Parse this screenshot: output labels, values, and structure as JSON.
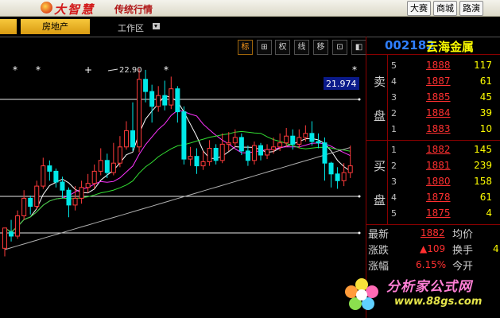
{
  "titlebar": {
    "app_name": "大智慧",
    "slogan": "传统行情",
    "buttons": [
      "大赛",
      "商城",
      "路演"
    ]
  },
  "tabs": {
    "sector": "房地产",
    "workspace": "工作区"
  },
  "chart_toolbar": {
    "buttons": [
      "标",
      "⊞",
      "权",
      "线",
      "移",
      "⊡",
      "◧"
    ]
  },
  "chart": {
    "high_label": "22.90",
    "cursor_value": "21.974",
    "candles": [
      [
        2.1,
        3.6,
        1.5,
        3.3
      ],
      [
        3.3,
        3.0,
        2.6,
        4.2
      ],
      [
        3.0,
        4.5,
        2.8,
        4.9
      ],
      [
        4.5,
        5.8,
        4.2,
        6.4
      ],
      [
        5.8,
        5.2,
        4.6,
        6.0
      ],
      [
        5.2,
        6.7,
        5.0,
        7.1
      ],
      [
        6.7,
        8.2,
        6.5,
        8.8
      ],
      [
        8.2,
        7.8,
        7.1,
        8.6
      ],
      [
        7.8,
        7.0,
        6.6,
        8.0
      ],
      [
        7.0,
        6.4,
        5.8,
        7.4
      ],
      [
        6.4,
        5.3,
        4.4,
        6.6
      ],
      [
        5.3,
        5.8,
        4.9,
        6.7
      ],
      [
        5.8,
        6.6,
        5.4,
        7.1
      ],
      [
        6.6,
        6.9,
        6.2,
        7.6
      ],
      [
        6.9,
        7.8,
        6.5,
        8.3
      ],
      [
        7.8,
        8.6,
        7.5,
        9.5
      ],
      [
        8.6,
        7.7,
        7.3,
        9.1
      ],
      [
        7.7,
        8.4,
        7.5,
        9.9
      ],
      [
        8.4,
        9.6,
        8.1,
        10.4
      ],
      [
        9.6,
        10.8,
        9.4,
        11.5
      ],
      [
        10.8,
        9.6,
        9.3,
        12.9
      ],
      [
        9.6,
        14.6,
        9.2,
        15.4
      ],
      [
        14.6,
        13.7,
        12.9,
        15.3
      ],
      [
        13.7,
        12.6,
        11.4,
        14.2
      ],
      [
        12.6,
        13.4,
        12.2,
        14.1
      ],
      [
        13.4,
        12.7,
        12.3,
        14.5
      ],
      [
        12.7,
        13.9,
        12.4,
        14.8
      ],
      [
        13.9,
        12.2,
        11.4,
        14.1
      ],
      [
        12.2,
        8.7,
        8.3,
        12.6
      ],
      [
        8.7,
        8.9,
        8.2,
        9.6
      ],
      [
        8.9,
        8.2,
        7.6,
        9.5
      ],
      [
        8.2,
        8.5,
        7.9,
        9.3
      ],
      [
        8.5,
        9.5,
        8.2,
        10.1
      ],
      [
        9.5,
        8.6,
        8.3,
        9.8
      ],
      [
        8.6,
        9.8,
        8.4,
        10.6
      ],
      [
        9.8,
        9.9,
        9.3,
        10.7
      ],
      [
        9.9,
        10.3,
        9.6,
        10.9
      ],
      [
        10.3,
        9.3,
        9.0,
        10.6
      ],
      [
        9.3,
        8.6,
        8.2,
        9.7
      ],
      [
        8.6,
        9.7,
        8.3,
        10.0
      ],
      [
        9.7,
        9.0,
        8.6,
        9.9
      ],
      [
        9.0,
        9.4,
        8.7,
        9.8
      ],
      [
        9.4,
        9.6,
        9.1,
        10.3
      ],
      [
        9.6,
        9.9,
        9.3,
        10.6
      ],
      [
        9.9,
        10.4,
        9.6,
        11.0
      ],
      [
        10.4,
        9.8,
        9.4,
        10.9
      ],
      [
        9.8,
        10.3,
        9.5,
        10.9
      ],
      [
        10.3,
        10.6,
        10.0,
        11.2
      ],
      [
        10.6,
        10.0,
        9.7,
        11.5
      ],
      [
        10.0,
        9.9,
        9.5,
        10.6
      ],
      [
        9.9,
        8.4,
        7.1,
        10.3
      ],
      [
        8.4,
        7.6,
        6.6,
        8.5
      ],
      [
        7.6,
        7.1,
        6.5,
        8.1
      ],
      [
        7.1,
        7.7,
        6.7,
        8.4
      ],
      [
        7.7,
        8.2,
        7.3,
        9.7
      ]
    ]
  },
  "panel": {
    "code": "002182",
    "name": "云海金属",
    "sell_label_1": "卖",
    "sell_label_2": "盘",
    "buy_label_1": "买",
    "buy_label_2": "盘",
    "sell": [
      {
        "level": "5",
        "price": "1888",
        "vol": "117"
      },
      {
        "level": "4",
        "price": "1887",
        "vol": "61"
      },
      {
        "level": "3",
        "price": "1885",
        "vol": "45"
      },
      {
        "level": "2",
        "price": "1884",
        "vol": "39"
      },
      {
        "level": "1",
        "price": "1883",
        "vol": "10"
      }
    ],
    "buy": [
      {
        "level": "1",
        "price": "1882",
        "vol": "145"
      },
      {
        "level": "2",
        "price": "1881",
        "vol": "239"
      },
      {
        "level": "3",
        "price": "1880",
        "vol": "158"
      },
      {
        "level": "4",
        "price": "1878",
        "vol": "61"
      },
      {
        "level": "5",
        "price": "1875",
        "vol": "4"
      }
    ],
    "quote": {
      "latest_label": "最新",
      "latest_value": "1882",
      "avg_label": "均价",
      "avg_value": "",
      "change_label": "涨跌",
      "change_value": "▲109",
      "turnover_label": "换手",
      "turnover_value": "4",
      "pct_label": "涨幅",
      "pct_value": "6.15%",
      "open_label": "今开"
    }
  },
  "watermark": {
    "name": "分析家公式网",
    "url": "www.88gs.com"
  }
}
